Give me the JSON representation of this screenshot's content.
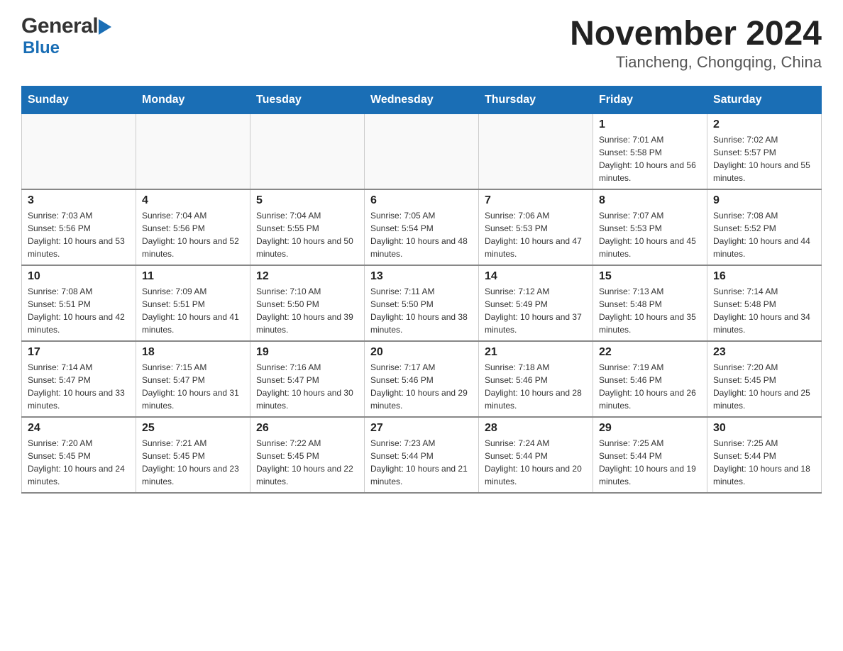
{
  "header": {
    "logo": {
      "general": "General",
      "blue": "Blue",
      "arrow": "▶"
    },
    "title": "November 2024",
    "subtitle": "Tiancheng, Chongqing, China"
  },
  "calendar": {
    "days_of_week": [
      "Sunday",
      "Monday",
      "Tuesday",
      "Wednesday",
      "Thursday",
      "Friday",
      "Saturday"
    ],
    "weeks": [
      [
        {
          "day": "",
          "info": ""
        },
        {
          "day": "",
          "info": ""
        },
        {
          "day": "",
          "info": ""
        },
        {
          "day": "",
          "info": ""
        },
        {
          "day": "",
          "info": ""
        },
        {
          "day": "1",
          "info": "Sunrise: 7:01 AM\nSunset: 5:58 PM\nDaylight: 10 hours and 56 minutes."
        },
        {
          "day": "2",
          "info": "Sunrise: 7:02 AM\nSunset: 5:57 PM\nDaylight: 10 hours and 55 minutes."
        }
      ],
      [
        {
          "day": "3",
          "info": "Sunrise: 7:03 AM\nSunset: 5:56 PM\nDaylight: 10 hours and 53 minutes."
        },
        {
          "day": "4",
          "info": "Sunrise: 7:04 AM\nSunset: 5:56 PM\nDaylight: 10 hours and 52 minutes."
        },
        {
          "day": "5",
          "info": "Sunrise: 7:04 AM\nSunset: 5:55 PM\nDaylight: 10 hours and 50 minutes."
        },
        {
          "day": "6",
          "info": "Sunrise: 7:05 AM\nSunset: 5:54 PM\nDaylight: 10 hours and 48 minutes."
        },
        {
          "day": "7",
          "info": "Sunrise: 7:06 AM\nSunset: 5:53 PM\nDaylight: 10 hours and 47 minutes."
        },
        {
          "day": "8",
          "info": "Sunrise: 7:07 AM\nSunset: 5:53 PM\nDaylight: 10 hours and 45 minutes."
        },
        {
          "day": "9",
          "info": "Sunrise: 7:08 AM\nSunset: 5:52 PM\nDaylight: 10 hours and 44 minutes."
        }
      ],
      [
        {
          "day": "10",
          "info": "Sunrise: 7:08 AM\nSunset: 5:51 PM\nDaylight: 10 hours and 42 minutes."
        },
        {
          "day": "11",
          "info": "Sunrise: 7:09 AM\nSunset: 5:51 PM\nDaylight: 10 hours and 41 minutes."
        },
        {
          "day": "12",
          "info": "Sunrise: 7:10 AM\nSunset: 5:50 PM\nDaylight: 10 hours and 39 minutes."
        },
        {
          "day": "13",
          "info": "Sunrise: 7:11 AM\nSunset: 5:50 PM\nDaylight: 10 hours and 38 minutes."
        },
        {
          "day": "14",
          "info": "Sunrise: 7:12 AM\nSunset: 5:49 PM\nDaylight: 10 hours and 37 minutes."
        },
        {
          "day": "15",
          "info": "Sunrise: 7:13 AM\nSunset: 5:48 PM\nDaylight: 10 hours and 35 minutes."
        },
        {
          "day": "16",
          "info": "Sunrise: 7:14 AM\nSunset: 5:48 PM\nDaylight: 10 hours and 34 minutes."
        }
      ],
      [
        {
          "day": "17",
          "info": "Sunrise: 7:14 AM\nSunset: 5:47 PM\nDaylight: 10 hours and 33 minutes."
        },
        {
          "day": "18",
          "info": "Sunrise: 7:15 AM\nSunset: 5:47 PM\nDaylight: 10 hours and 31 minutes."
        },
        {
          "day": "19",
          "info": "Sunrise: 7:16 AM\nSunset: 5:47 PM\nDaylight: 10 hours and 30 minutes."
        },
        {
          "day": "20",
          "info": "Sunrise: 7:17 AM\nSunset: 5:46 PM\nDaylight: 10 hours and 29 minutes."
        },
        {
          "day": "21",
          "info": "Sunrise: 7:18 AM\nSunset: 5:46 PM\nDaylight: 10 hours and 28 minutes."
        },
        {
          "day": "22",
          "info": "Sunrise: 7:19 AM\nSunset: 5:46 PM\nDaylight: 10 hours and 26 minutes."
        },
        {
          "day": "23",
          "info": "Sunrise: 7:20 AM\nSunset: 5:45 PM\nDaylight: 10 hours and 25 minutes."
        }
      ],
      [
        {
          "day": "24",
          "info": "Sunrise: 7:20 AM\nSunset: 5:45 PM\nDaylight: 10 hours and 24 minutes."
        },
        {
          "day": "25",
          "info": "Sunrise: 7:21 AM\nSunset: 5:45 PM\nDaylight: 10 hours and 23 minutes."
        },
        {
          "day": "26",
          "info": "Sunrise: 7:22 AM\nSunset: 5:45 PM\nDaylight: 10 hours and 22 minutes."
        },
        {
          "day": "27",
          "info": "Sunrise: 7:23 AM\nSunset: 5:44 PM\nDaylight: 10 hours and 21 minutes."
        },
        {
          "day": "28",
          "info": "Sunrise: 7:24 AM\nSunset: 5:44 PM\nDaylight: 10 hours and 20 minutes."
        },
        {
          "day": "29",
          "info": "Sunrise: 7:25 AM\nSunset: 5:44 PM\nDaylight: 10 hours and 19 minutes."
        },
        {
          "day": "30",
          "info": "Sunrise: 7:25 AM\nSunset: 5:44 PM\nDaylight: 10 hours and 18 minutes."
        }
      ]
    ]
  }
}
